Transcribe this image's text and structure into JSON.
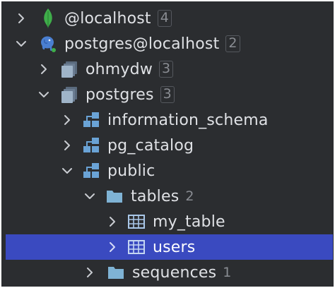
{
  "tree": {
    "rows": [
      {
        "label": "@localhost",
        "count": "4"
      },
      {
        "label": "postgres@localhost",
        "count": "2"
      },
      {
        "label": "ohmydw",
        "count": "3"
      },
      {
        "label": "postgres",
        "count": "3"
      },
      {
        "label": "information_schema"
      },
      {
        "label": "pg_catalog"
      },
      {
        "label": "public"
      },
      {
        "label": "tables",
        "count": "2"
      },
      {
        "label": "my_table"
      },
      {
        "label": "users"
      },
      {
        "label": "sequences",
        "count": "1"
      }
    ]
  },
  "colors": {
    "background": "#2b2d30",
    "text": "#dfe1e5",
    "selection": "#3a4ac0",
    "count_text": "#8a8d93",
    "mongodb_leaf": "#3fae4a",
    "postgres_blue": "#4a7fd1",
    "folder": "#7fb3d5",
    "table_icon": "#a9c7e8",
    "schema_icon": "#6aa3d6"
  }
}
